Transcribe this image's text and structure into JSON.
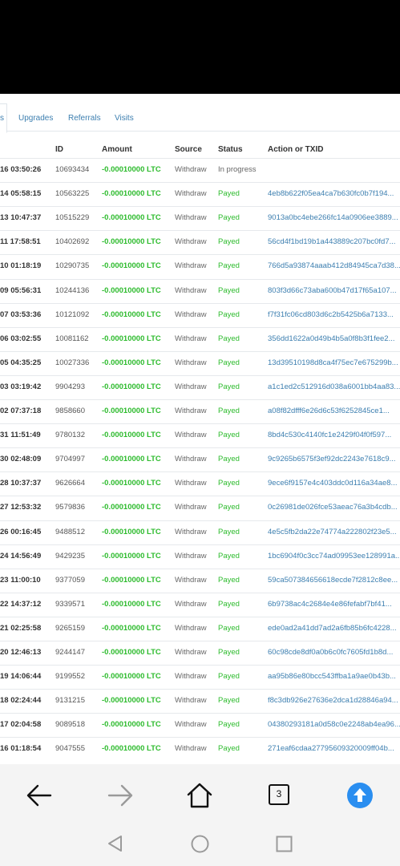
{
  "tabs": {
    "partial_label": "s",
    "items": [
      "Upgrades",
      "Referrals",
      "Visits"
    ]
  },
  "table": {
    "headers": [
      "ID",
      "Amount",
      "Source",
      "Status",
      "Action or TXID"
    ],
    "rows": [
      {
        "date": "16 03:50:26",
        "id": "10693434",
        "amount": "-0.00010000 LTC",
        "source": "Withdraw",
        "status": "In progress",
        "tx": ""
      },
      {
        "date": "14 05:58:15",
        "id": "10563225",
        "amount": "-0.00010000 LTC",
        "source": "Withdraw",
        "status": "Payed",
        "tx": "4eb8b622f05ea4ca7b630fc0b7f194..."
      },
      {
        "date": "13 10:47:37",
        "id": "10515229",
        "amount": "-0.00010000 LTC",
        "source": "Withdraw",
        "status": "Payed",
        "tx": "9013a0bc4ebe266fc14a0906ee3889..."
      },
      {
        "date": "11 17:58:51",
        "id": "10402692",
        "amount": "-0.00010000 LTC",
        "source": "Withdraw",
        "status": "Payed",
        "tx": "56cd4f1bd19b1a443889c207bc0fd7..."
      },
      {
        "date": "10 01:18:19",
        "id": "10290735",
        "amount": "-0.00010000 LTC",
        "source": "Withdraw",
        "status": "Payed",
        "tx": "766d5a93874aaab412d84945ca7d38..."
      },
      {
        "date": "09 05:56:31",
        "id": "10244136",
        "amount": "-0.00010000 LTC",
        "source": "Withdraw",
        "status": "Payed",
        "tx": "803f3d66c73aba600b47d17f65a107..."
      },
      {
        "date": "07 03:53:36",
        "id": "10121092",
        "amount": "-0.00010000 LTC",
        "source": "Withdraw",
        "status": "Payed",
        "tx": "f7f31fc06cd803d6c2b5425b6a7133..."
      },
      {
        "date": "06 03:02:55",
        "id": "10081162",
        "amount": "-0.00010000 LTC",
        "source": "Withdraw",
        "status": "Payed",
        "tx": "356dd1622a0d49b4b5a0f8b3f1fee2..."
      },
      {
        "date": "05 04:35:25",
        "id": "10027336",
        "amount": "-0.00010000 LTC",
        "source": "Withdraw",
        "status": "Payed",
        "tx": "13d39510198d8ca4f75ec7e675299b..."
      },
      {
        "date": "03 03:19:42",
        "id": "9904293",
        "amount": "-0.00010000 LTC",
        "source": "Withdraw",
        "status": "Payed",
        "tx": "a1c1ed2c512916d038a6001bb4aa83..."
      },
      {
        "date": "02 07:37:18",
        "id": "9858660",
        "amount": "-0.00010000 LTC",
        "source": "Withdraw",
        "status": "Payed",
        "tx": "a08f82dfff6e26d6c53f6252845ce1..."
      },
      {
        "date": "31 11:51:49",
        "id": "9780132",
        "amount": "-0.00010000 LTC",
        "source": "Withdraw",
        "status": "Payed",
        "tx": "8bd4c530c4140fc1e2429f04f0f597..."
      },
      {
        "date": "30 02:48:09",
        "id": "9704997",
        "amount": "-0.00010000 LTC",
        "source": "Withdraw",
        "status": "Payed",
        "tx": "9c9265b6575f3ef92dc2243e7618c9..."
      },
      {
        "date": "28 10:37:37",
        "id": "9626664",
        "amount": "-0.00010000 LTC",
        "source": "Withdraw",
        "status": "Payed",
        "tx": "9ece6f9157e4c403ddc0d116a34ae8..."
      },
      {
        "date": "27 12:53:32",
        "id": "9579836",
        "amount": "-0.00010000 LTC",
        "source": "Withdraw",
        "status": "Payed",
        "tx": "0c26981de026fce53aeac76a3b4cdb..."
      },
      {
        "date": "26 00:16:45",
        "id": "9488512",
        "amount": "-0.00010000 LTC",
        "source": "Withdraw",
        "status": "Payed",
        "tx": "4e5c5fb2da22e74774a222802f23e5..."
      },
      {
        "date": "24 14:56:49",
        "id": "9429235",
        "amount": "-0.00010000 LTC",
        "source": "Withdraw",
        "status": "Payed",
        "tx": "1bc6904f0c3cc74ad09953ee128991a..."
      },
      {
        "date": "23 11:00:10",
        "id": "9377059",
        "amount": "-0.00010000 LTC",
        "source": "Withdraw",
        "status": "Payed",
        "tx": "59ca507384656618ecde7f2812c8ee..."
      },
      {
        "date": "22 14:37:12",
        "id": "9339571",
        "amount": "-0.00010000 LTC",
        "source": "Withdraw",
        "status": "Payed",
        "tx": "6b9738ac4c2684e4e86fefabf7bf41..."
      },
      {
        "date": "21 02:25:58",
        "id": "9265159",
        "amount": "-0.00010000 LTC",
        "source": "Withdraw",
        "status": "Payed",
        "tx": "ede0ad2a41dd7ad2a6fb85b6fc4228..."
      },
      {
        "date": "20 12:46:13",
        "id": "9244147",
        "amount": "-0.00010000 LTC",
        "source": "Withdraw",
        "status": "Payed",
        "tx": "60c98cde8df0a0b6c0fc7605fd1b8d..."
      },
      {
        "date": "19 14:06:44",
        "id": "9199552",
        "amount": "-0.00010000 LTC",
        "source": "Withdraw",
        "status": "Payed",
        "tx": "aa95b86e80bcc543ffba1a9ae0b43b..."
      },
      {
        "date": "18 02:24:44",
        "id": "9131215",
        "amount": "-0.00010000 LTC",
        "source": "Withdraw",
        "status": "Payed",
        "tx": "f8c3db926e27636e2dca1d28846a94..."
      },
      {
        "date": "17 02:04:58",
        "id": "9089518",
        "amount": "-0.00010000 LTC",
        "source": "Withdraw",
        "status": "Payed",
        "tx": "04380293181a0d58c0e2248ab4ea96..."
      },
      {
        "date": "16 01:18:54",
        "id": "9047555",
        "amount": "-0.00010000 LTC",
        "source": "Withdraw",
        "status": "Payed",
        "tx": "271eaf6cdaa27795609320009ff04b..."
      }
    ]
  },
  "browser_nav": {
    "tab_count": "3",
    "icons": [
      "back-arrow-icon",
      "forward-arrow-icon",
      "home-icon",
      "tabs-icon",
      "upload-icon"
    ],
    "accent": "#2a8ef0"
  },
  "system_nav": {
    "icons": [
      "back-triangle-icon",
      "home-circle-icon",
      "recents-square-icon"
    ]
  }
}
